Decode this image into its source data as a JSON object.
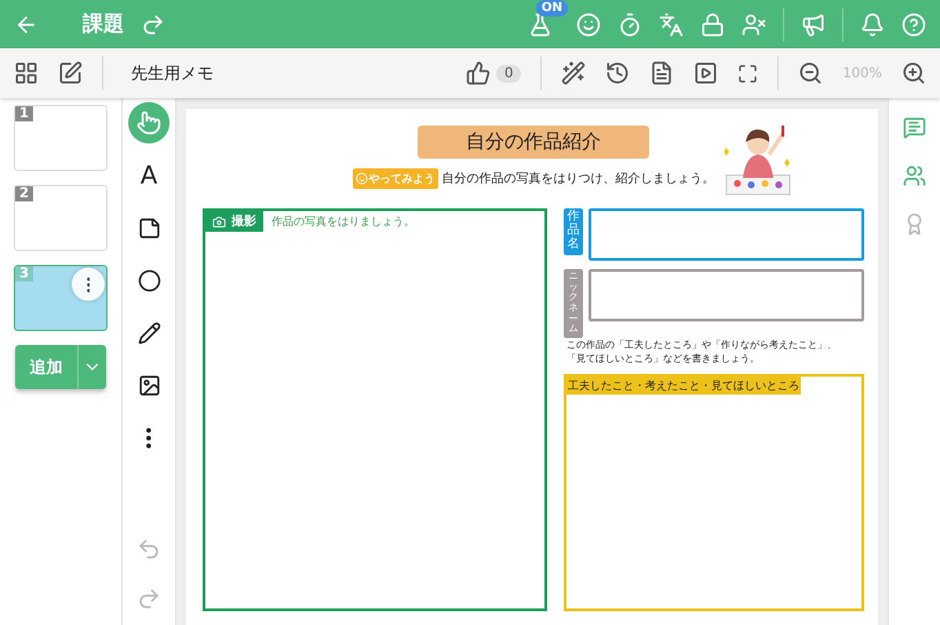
{
  "header": {
    "title": "課題",
    "badge": "ON"
  },
  "toolbar": {
    "memo": "先生用メモ",
    "likes": "0",
    "zoom": "100%"
  },
  "slides": [
    {
      "number": "1",
      "selected": false
    },
    {
      "number": "2",
      "selected": false
    },
    {
      "number": "3",
      "selected": true
    }
  ],
  "add_button": "追加",
  "tools": [
    {
      "kind": "pointer",
      "selected": true
    },
    {
      "kind": "text",
      "label": "A",
      "selected": false
    },
    {
      "kind": "note",
      "selected": false
    },
    {
      "kind": "shape",
      "selected": false
    },
    {
      "kind": "pen",
      "selected": false
    },
    {
      "kind": "image",
      "selected": false
    },
    {
      "kind": "more",
      "selected": false
    }
  ],
  "worksheet": {
    "title": "自分の作品紹介",
    "tag": "やってみよう",
    "instruction": "自分の作品の写真をはりつけ、紹介しましょう。",
    "photo_label": "撮影",
    "photo_hint": "作品の写真をはりましょう。",
    "work_name_label": "作品名",
    "nickname_label": "ニックネーム",
    "note": [
      "この作品の「工夫したところ」や「作りながら考えたこと」、",
      "「見てほしいところ」などを書きましょう。"
    ],
    "comment_label": "工夫したこと・考えたこと・見てほしいところ"
  },
  "side_panel": [
    {
      "kind": "comments",
      "selected": true
    },
    {
      "kind": "members",
      "selected": true
    },
    {
      "kind": "badge",
      "selected": false
    }
  ]
}
